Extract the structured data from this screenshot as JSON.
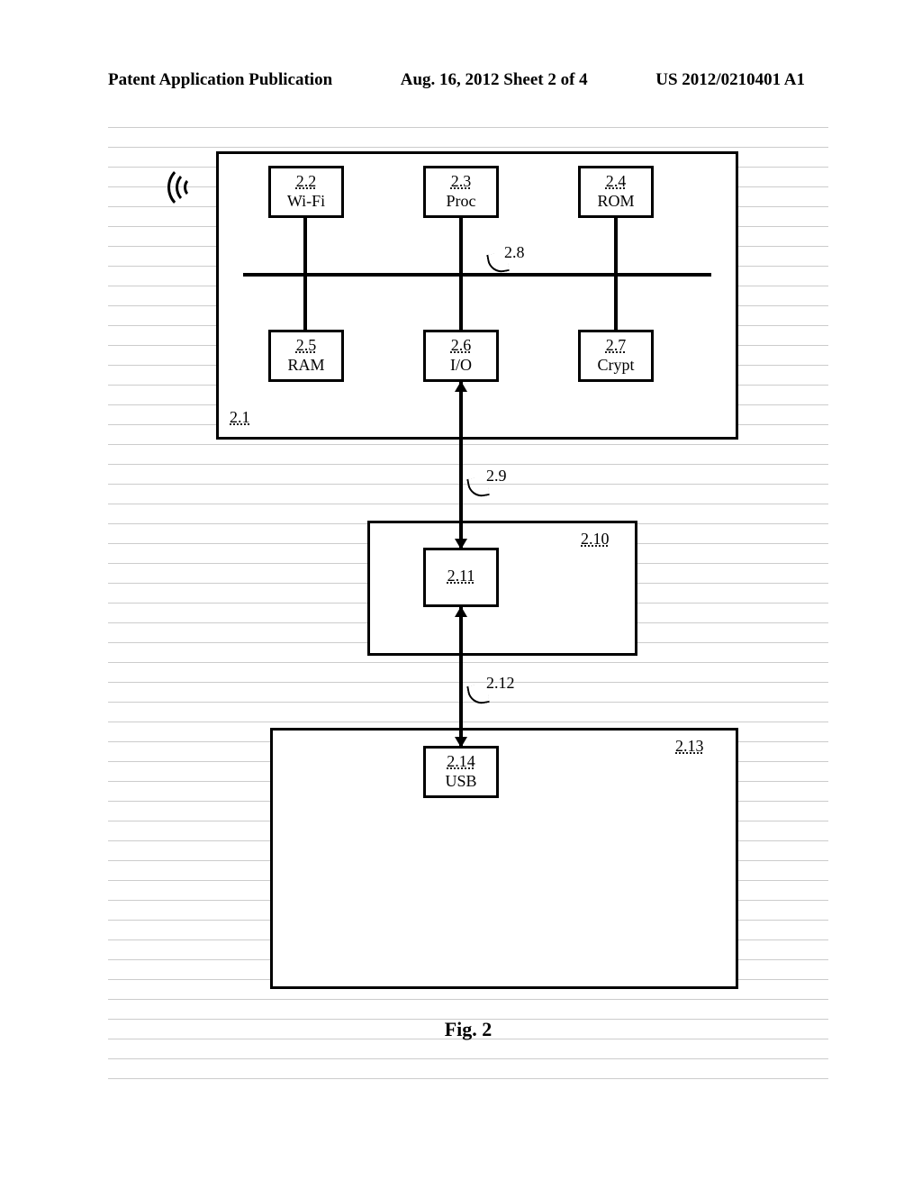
{
  "header": {
    "left": "Patent Application Publication",
    "center": "Aug. 16, 2012  Sheet 2 of 4",
    "right": "US 2012/0210401 A1"
  },
  "figure": {
    "caption": "Fig. 2"
  },
  "blocks": {
    "b22": {
      "ref": "2.2",
      "txt": "Wi-Fi"
    },
    "b23": {
      "ref": "2.3",
      "txt": "Proc"
    },
    "b24": {
      "ref": "2.4",
      "txt": "ROM"
    },
    "b25": {
      "ref": "2.5",
      "txt": "RAM"
    },
    "b26": {
      "ref": "2.6",
      "txt": "I/O"
    },
    "b27": {
      "ref": "2.7",
      "txt": "Crypt"
    },
    "b211": {
      "ref": "2.11",
      "txt": ""
    },
    "b214": {
      "ref": "2.14",
      "txt": "USB"
    }
  },
  "container_ids": {
    "device": "2.1",
    "mid": "2.10",
    "host": "2.13"
  },
  "labels": {
    "bus": "2.8",
    "link1": "2.9",
    "link2": "2.12"
  }
}
